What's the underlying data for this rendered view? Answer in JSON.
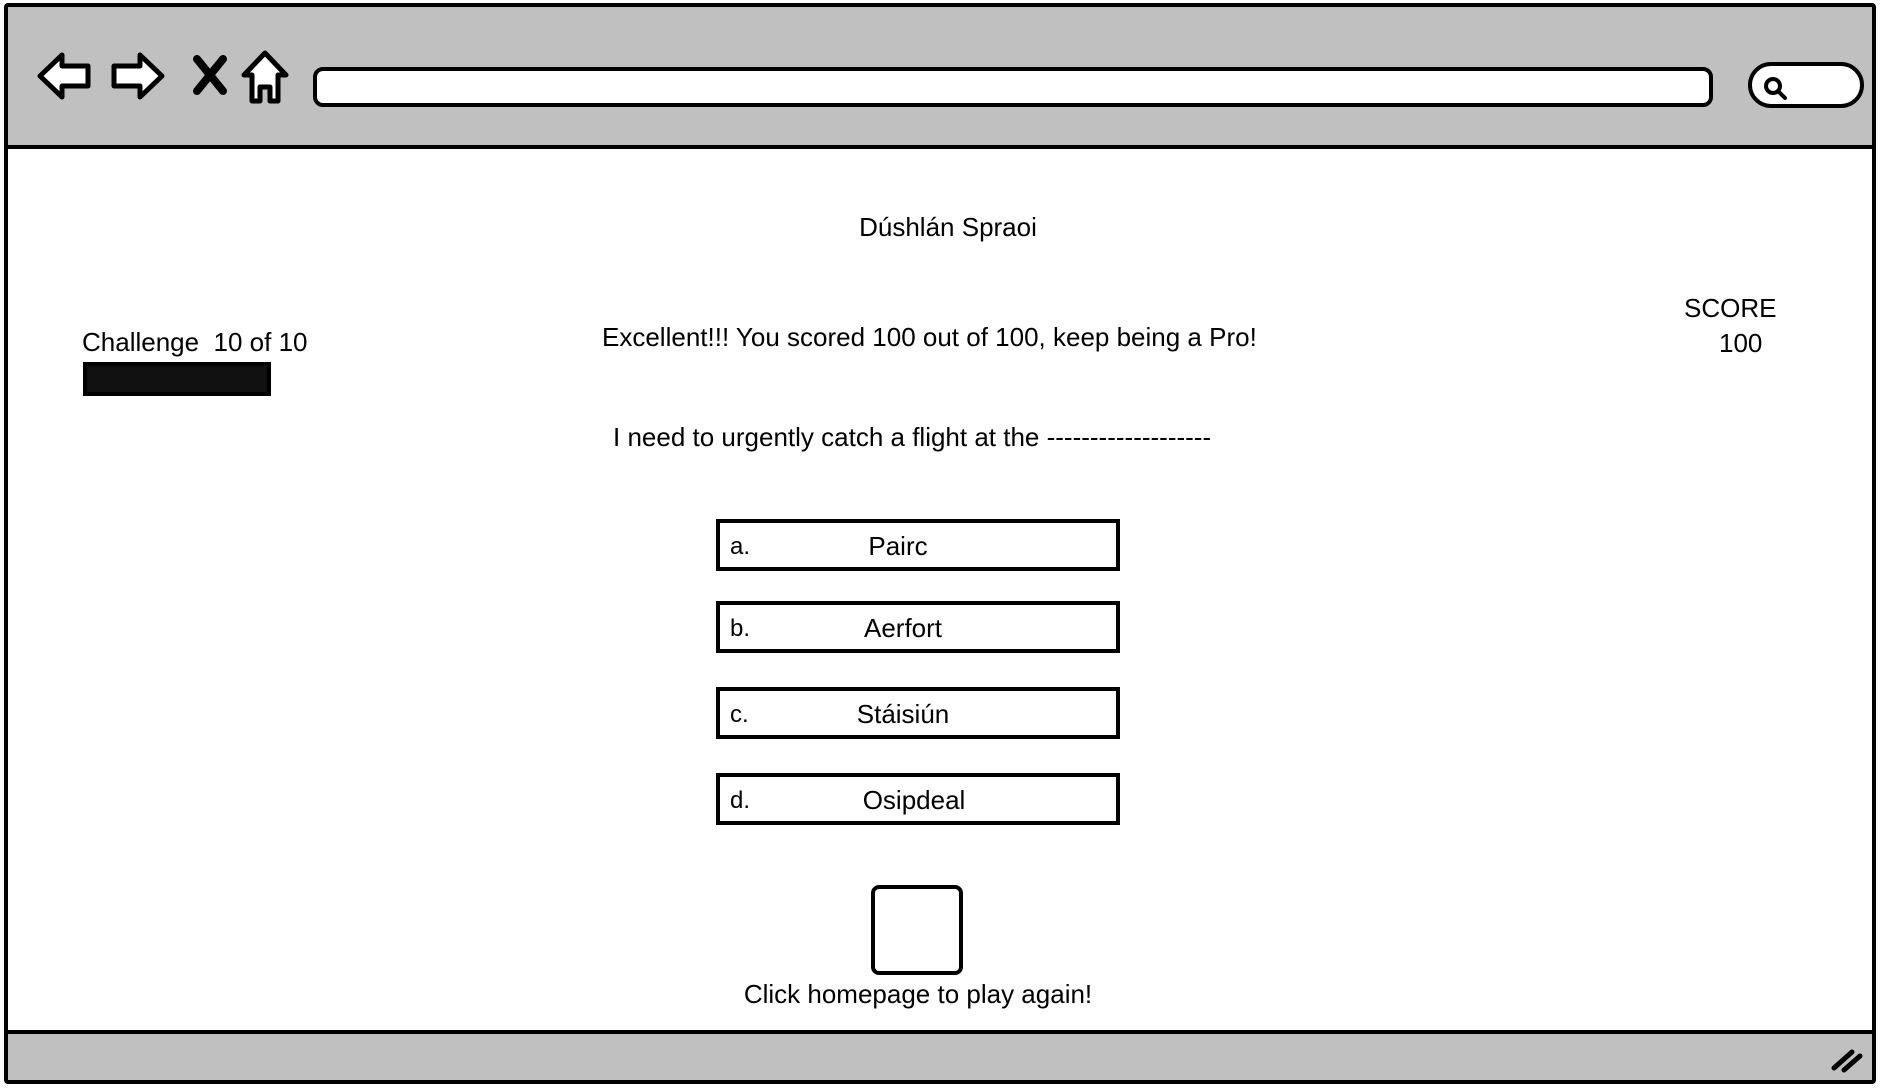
{
  "browser": {
    "nav_icons": [
      "back-arrow-icon",
      "forward-arrow-icon",
      "stop-x-icon",
      "home-icon"
    ],
    "address_value": "",
    "search_icon": "search-icon",
    "chrome_color": "#c0c0c0"
  },
  "page": {
    "title": "Dúshlán Spraoi",
    "challenge_label": "Challenge  10 of 10",
    "progress_fraction": 1.0,
    "result_message": "Excellent!!! You scored 100 out of 100, keep being a Pro!",
    "score_label": "SCORE",
    "score_value": "100",
    "question": "I need to urgently catch a flight at the -------------------",
    "options": [
      {
        "letter": "a.",
        "text": "Pairc"
      },
      {
        "letter": "b.",
        "text": "Aerfort"
      },
      {
        "letter": "c.",
        "text": "Stáisiún"
      },
      {
        "letter": "d.",
        "text": "Osipdeal"
      }
    ],
    "play_again": "Click  homepage to play again!"
  }
}
